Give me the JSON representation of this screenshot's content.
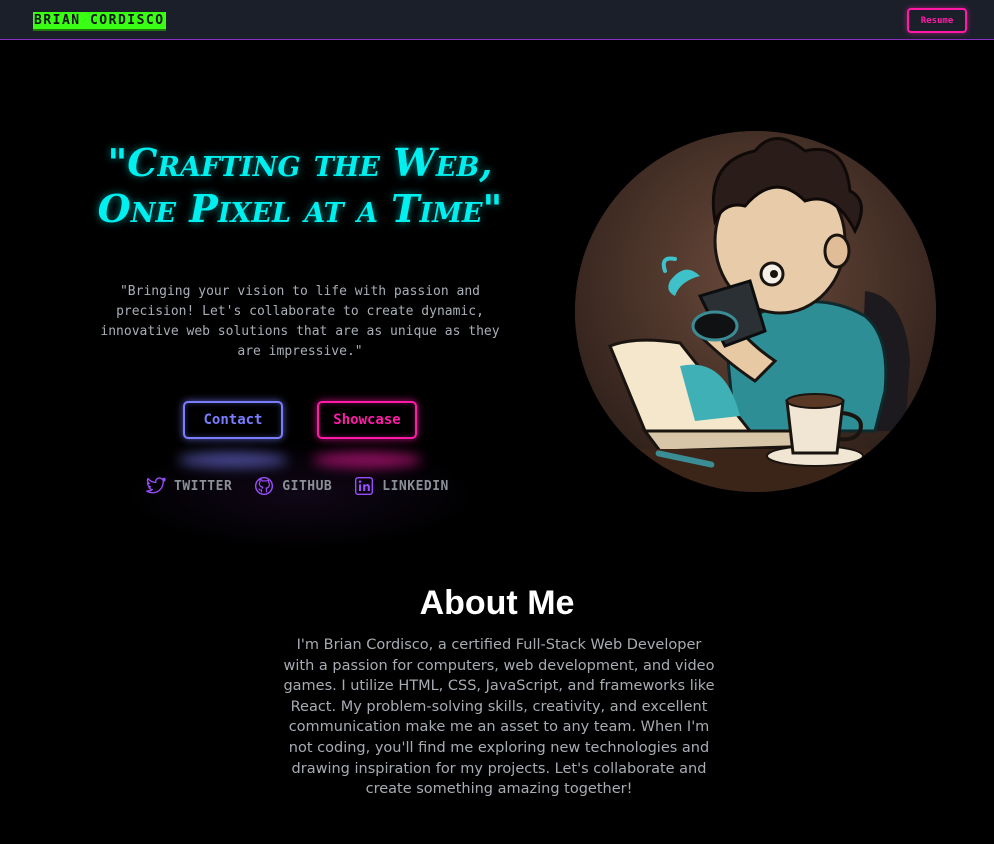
{
  "nav": {
    "brand": "BRIAN CORDISCO",
    "resume_label": "Resume"
  },
  "hero": {
    "title": "\"Crafting the Web, One Pixel at a Time\"",
    "subtitle": "\"Bringing your vision to life with passion and precision! Let's collaborate to create dynamic, innovative web solutions that are as unique as they are impressive.\"",
    "contact_label": "Contact",
    "showcase_label": "Showcase",
    "socials": [
      {
        "label": "TWITTER",
        "icon": "twitter-icon"
      },
      {
        "label": "GITHUB",
        "icon": "github-icon"
      },
      {
        "label": "LINKEDIN",
        "icon": "linkedin-icon"
      }
    ]
  },
  "about": {
    "title": "About Me",
    "text": "I'm Brian Cordisco, a certified Full-Stack Web Developer with a passion for computers, web development, and video games. I utilize HTML, CSS, JavaScript, and frameworks like React. My problem-solving skills, creativity, and excellent communication make me an asset to any team. When I'm not coding, you'll find me exploring new technologies and drawing inspiration for my projects. Let's collaborate and create something amazing together!"
  },
  "colors": {
    "accent_cyan": "#00f0f0",
    "accent_pink": "#ff1aa8",
    "accent_blue": "#7b7dff",
    "brand_green": "#39ff14",
    "nav_bg": "#1b1f2a"
  }
}
